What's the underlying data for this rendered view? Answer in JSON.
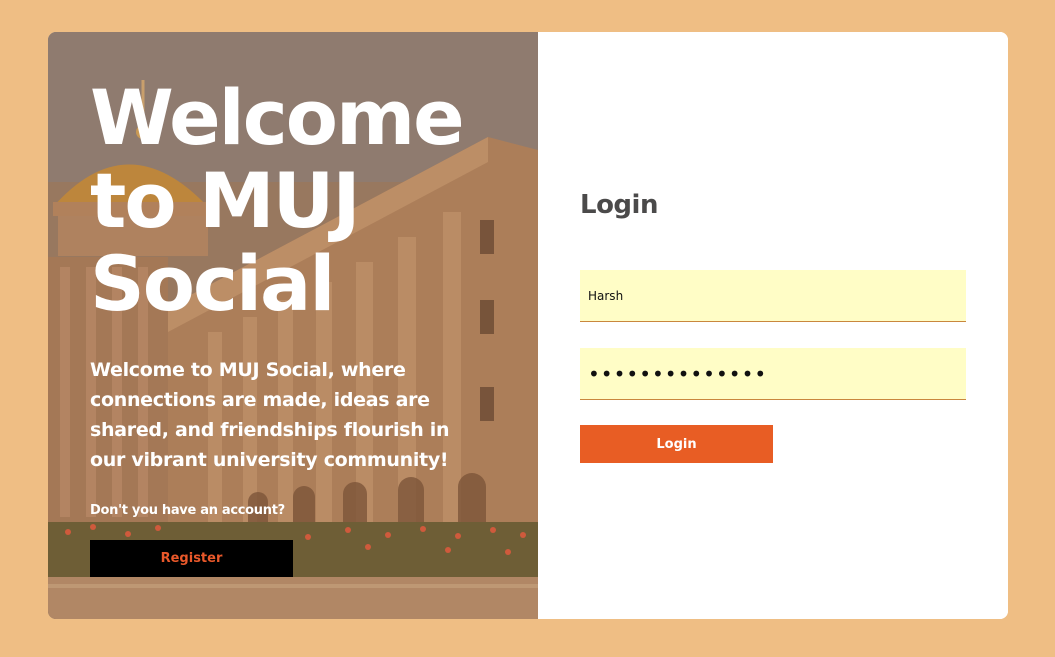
{
  "hero": {
    "title_line1": "Welcome",
    "title_line2": "to MUJ",
    "title_line3": "Social",
    "description": "Welcome to MUJ Social, where connections are made, ideas are shared, and friendships flourish in our vibrant university community!",
    "no_account_text": "Don't you have an account?",
    "register_label": "Register"
  },
  "login": {
    "title": "Login",
    "username_value": "Harsh",
    "password_value": "••••••••••••••",
    "button_label": "Login"
  },
  "colors": {
    "page_background": "#efbe84",
    "accent": "#e85d24",
    "input_background": "#fffdc6",
    "register_background": "#000000"
  },
  "icons": {
    "background_image": "university-building-image"
  }
}
